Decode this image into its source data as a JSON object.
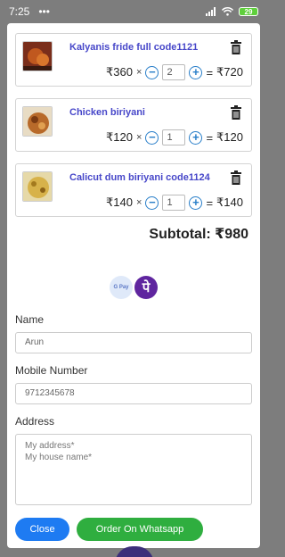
{
  "status_bar": {
    "time": "7:25",
    "dots": "•••",
    "battery": "29"
  },
  "cart": {
    "items": [
      {
        "name": "Kalyanis fride full code1121",
        "price": "₹360",
        "times": "×",
        "qty": "2",
        "equals": "=",
        "total": "₹720",
        "minus": "−",
        "plus": "+"
      },
      {
        "name": "Chicken biriyani",
        "price": "₹120",
        "times": "×",
        "qty": "1",
        "equals": "=",
        "total": "₹120",
        "minus": "−",
        "plus": "+"
      },
      {
        "name": "Calicut dum biriyani code1124",
        "price": "₹140",
        "times": "×",
        "qty": "1",
        "equals": "=",
        "total": "₹140",
        "minus": "−",
        "plus": "+"
      }
    ],
    "subtotal": "Subtotal: ₹980"
  },
  "payment": {
    "gpay_text": "G Pay",
    "phonepe_text": "पे"
  },
  "form": {
    "name_label": "Name",
    "name_value": "Arun",
    "mobile_label": "Mobile Number",
    "mobile_value": "9712345678",
    "address_label": "Address",
    "address_placeholder": "My address*\nMy house name*"
  },
  "actions": {
    "close_label": "Close",
    "whatsapp_label": "Order On Whatsapp"
  },
  "colors": {
    "accent": "#4747c9",
    "close": "#1e7bf2",
    "whatsapp": "#2fae3f"
  }
}
